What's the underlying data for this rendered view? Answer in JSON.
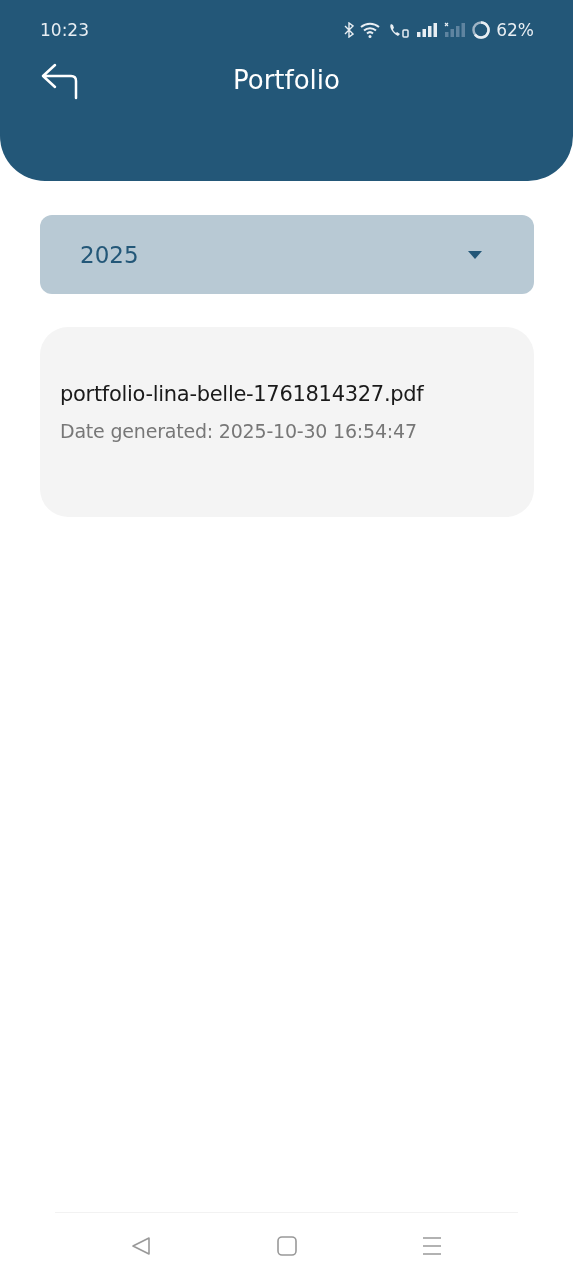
{
  "status_bar": {
    "time": "10:23",
    "battery": "62%"
  },
  "header": {
    "title": "Portfolio"
  },
  "year_dropdown": {
    "value": "2025"
  },
  "files": [
    {
      "name": "portfolio-lina-belle-1761814327.pdf",
      "date": "Date generated: 2025-10-30 16:54:47"
    }
  ]
}
